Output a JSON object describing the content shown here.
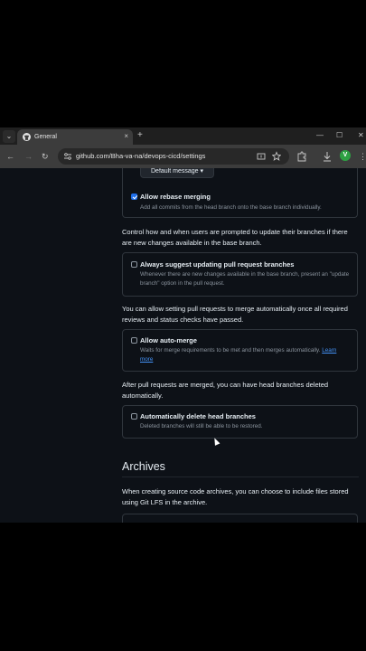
{
  "browser": {
    "tab": {
      "title": "General",
      "close": "×"
    },
    "tab_menu_icon": "⌄",
    "new_tab": "+",
    "window": {
      "minimize": "—",
      "maximize": "☐",
      "close": "✕"
    },
    "nav": {
      "back": "←",
      "forward": "→",
      "reload": "↻"
    },
    "url": "github.com/Bha-va-na/devops-cicd/settings",
    "avatar_letter": "V",
    "menu": "⋮"
  },
  "page": {
    "merge_message_dropdown": "Default message ▾",
    "rebase": {
      "title": "Allow rebase merging",
      "desc": "Add all commits from the head branch onto the base branch individually.",
      "checked": true
    },
    "update_branch_para": "Control how and when users are prompted to update their branches if there are new changes available in the base branch.",
    "suggest_update": {
      "title": "Always suggest updating pull request branches",
      "desc": "Whenever there are new changes available in the base branch, present an \"update branch\" option in the pull request.",
      "checked": false
    },
    "auto_merge_para": "You can allow setting pull requests to merge automatically once all required reviews and status checks have passed.",
    "auto_merge": {
      "title": "Allow auto-merge",
      "desc": "Waits for merge requirements to be met and then merges automatically.",
      "link": "Learn more",
      "checked": false
    },
    "delete_branch_para": "After pull requests are merged, you can have head branches deleted automatically.",
    "delete_branch": {
      "title": "Automatically delete head branches",
      "desc": "Deleted branches will still be able to be restored.",
      "checked": false
    },
    "archives": {
      "title": "Archives",
      "para": "When creating source code archives, you can choose to include files stored using Git LFS in the archive."
    }
  }
}
